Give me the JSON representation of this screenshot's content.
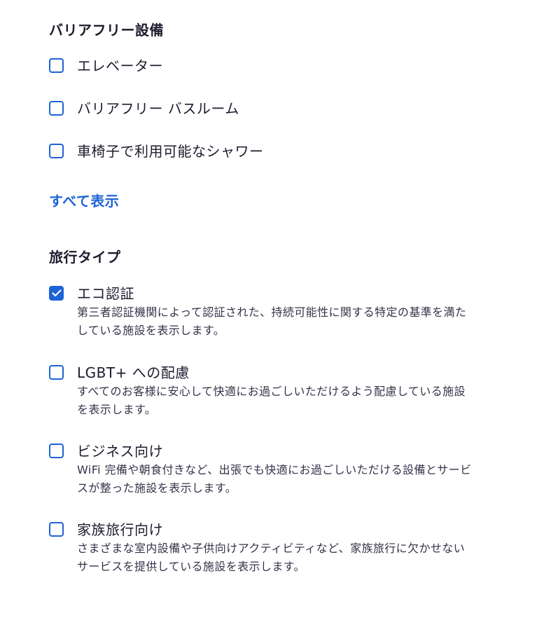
{
  "accessibility": {
    "title": "バリアフリー設備",
    "options": [
      {
        "label": "エレベーター",
        "checked": false
      },
      {
        "label": "バリアフリー バスルーム",
        "checked": false
      },
      {
        "label": "車椅子で利用可能なシャワー",
        "checked": false
      }
    ],
    "show_all_label": "すべて表示"
  },
  "travel_type": {
    "title": "旅行タイプ",
    "options": [
      {
        "label": "エコ認証",
        "description": "第三者認証機関によって認証された、持続可能性に関する特定の基準を満たしている施設を表示します。",
        "checked": true
      },
      {
        "label": "LGBT+ への配慮",
        "description": "すべてのお客様に安心して快適にお過ごしいただけるよう配慮している施設を表示します。",
        "checked": false
      },
      {
        "label": "ビジネス向け",
        "description": "WiFi 完備や朝食付きなど、出張でも快適にお過ごしいただける設備とサービスが整った施設を表示します。",
        "checked": false
      },
      {
        "label": "家族旅行向け",
        "description": "さまざまな室内設備や子供向けアクティビティなど、家族旅行に欠かせないサービスを提供している施設を表示します。",
        "checked": false
      }
    ]
  },
  "colors": {
    "accent": "#1e63d6",
    "text": "#1c1c2e",
    "background": "#ffffff"
  },
  "icons": {
    "checkbox_checked": "checkmark-icon"
  }
}
